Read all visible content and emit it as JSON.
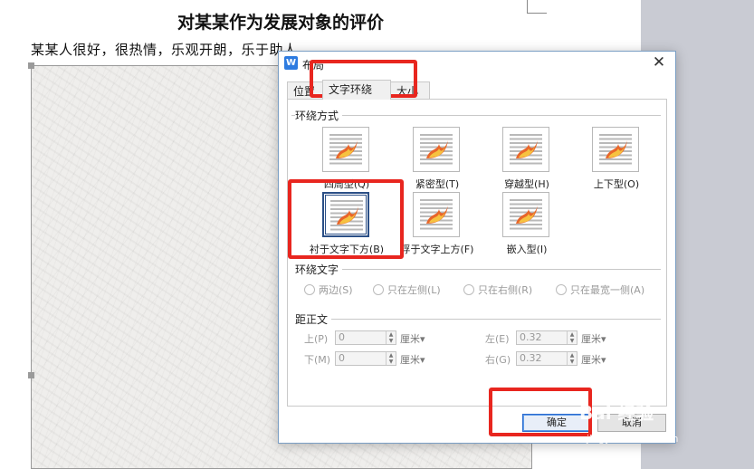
{
  "document": {
    "title": "对某某作为发展对象的评价",
    "body_text": "某某人很好，很热情，乐观开朗，乐于助人"
  },
  "dialog": {
    "title": "布局",
    "close_glyph": "✕",
    "app_icon": "W",
    "tabs": [
      {
        "label": "位置",
        "active": false
      },
      {
        "label": "文字环绕",
        "active": true
      },
      {
        "label": "大小",
        "active": false
      }
    ],
    "wrap_section": {
      "label": "环绕方式",
      "options": [
        {
          "label": "四周型(Q)",
          "selected": false
        },
        {
          "label": "紧密型(T)",
          "selected": false
        },
        {
          "label": "穿越型(H)",
          "selected": false
        },
        {
          "label": "上下型(O)",
          "selected": false
        },
        {
          "label": "衬于文字下方(B)",
          "selected": true
        },
        {
          "label": "浮于文字上方(F)",
          "selected": false
        },
        {
          "label": "嵌入型(I)",
          "selected": false
        }
      ]
    },
    "wrap_text_section": {
      "label": "环绕文字",
      "radios": [
        "两边(S)",
        "只在左侧(L)",
        "只在右侧(R)",
        "只在最宽一侧(A)"
      ]
    },
    "distance_section": {
      "label": "距正文",
      "top_label": "上(P)",
      "top_value": "0",
      "top_unit": "厘米",
      "bottom_label": "下(M)",
      "bottom_value": "0",
      "bottom_unit": "厘米",
      "left_label": "左(E)",
      "left_value": "0.32",
      "left_unit": "厘米",
      "right_label": "右(G)",
      "right_value": "0.32",
      "right_unit": "厘米"
    },
    "ok_label": "确定",
    "cancel_label": "取消"
  },
  "watermark": {
    "text": "Bai 经验",
    "url": "jingyan.baidu.com"
  },
  "colors": {
    "annotation": "#e8261f",
    "dialog_border": "#7a9ec4",
    "accent": "#2d6bd0"
  }
}
